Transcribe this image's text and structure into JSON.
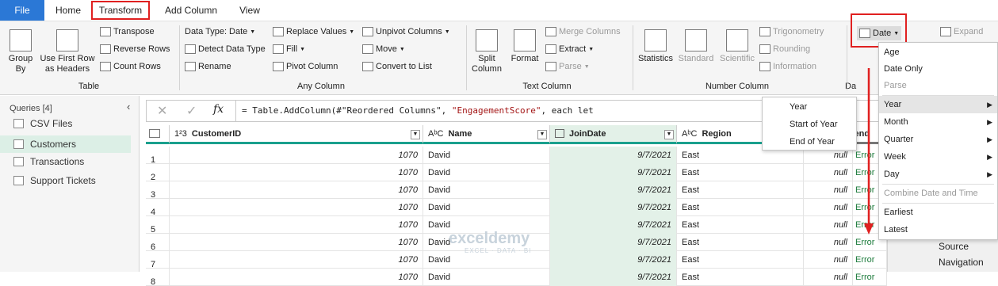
{
  "tabs": {
    "file": "File",
    "home": "Home",
    "transform": "Transform",
    "add_column": "Add Column",
    "view": "View"
  },
  "ribbon": {
    "group_by": "Group\nBy",
    "use_first_row": "Use First Row\nas Headers",
    "transpose": "Transpose",
    "reverse_rows": "Reverse Rows",
    "count_rows": "Count Rows",
    "table_group": "Table",
    "data_type": "Data Type: Date",
    "detect_data_type": "Detect Data Type",
    "rename": "Rename",
    "replace_values": "Replace Values",
    "fill": "Fill",
    "pivot_column": "Pivot Column",
    "unpivot_columns": "Unpivot Columns",
    "move": "Move",
    "convert_to_list": "Convert to List",
    "any_column_group": "Any Column",
    "split_column": "Split\nColumn",
    "format": "Format",
    "merge_columns": "Merge Columns",
    "extract": "Extract",
    "parse": "Parse",
    "text_column_group": "Text Column",
    "statistics": "Statistics",
    "standard": "Standard",
    "scientific": "Scientific",
    "trigonometry": "Trigonometry",
    "rounding": "Rounding",
    "information": "Information",
    "number_column_group": "Number Column",
    "date": "Date",
    "date_group_partial": "Da",
    "expand": "Expand"
  },
  "queries": {
    "header": "Queries [4]",
    "items": [
      "CSV Files",
      "Customers",
      "Transactions",
      "Support Tickets"
    ],
    "selected": 1
  },
  "formula": {
    "text_prefix": "= Table.AddColumn(#\"Reordered Columns\", ",
    "string": "\"EngagementScore\"",
    "text_suffix": ", each let"
  },
  "columns": {
    "customer_id": "CustomerID",
    "name": "Name",
    "join_date": "JoinDate",
    "region": "Region",
    "total_spend": "TotalSpend"
  },
  "rows": [
    {
      "n": "1",
      "id": "1070",
      "name": "David",
      "date": "9/7/2021",
      "region": "East",
      "spend": "null",
      "err": "Error"
    },
    {
      "n": "2",
      "id": "1070",
      "name": "David",
      "date": "9/7/2021",
      "region": "East",
      "spend": "null",
      "err": "Error"
    },
    {
      "n": "3",
      "id": "1070",
      "name": "David",
      "date": "9/7/2021",
      "region": "East",
      "spend": "null",
      "err": "Error"
    },
    {
      "n": "4",
      "id": "1070",
      "name": "David",
      "date": "9/7/2021",
      "region": "East",
      "spend": "null",
      "err": "Error"
    },
    {
      "n": "5",
      "id": "1070",
      "name": "David",
      "date": "9/7/2021",
      "region": "East",
      "spend": "null",
      "err": "Error"
    },
    {
      "n": "6",
      "id": "1070",
      "name": "David",
      "date": "9/7/2021",
      "region": "East",
      "spend": "null",
      "err": "Error"
    },
    {
      "n": "7",
      "id": "1070",
      "name": "David",
      "date": "9/7/2021",
      "region": "East",
      "spend": "null",
      "err": "Error"
    },
    {
      "n": "8",
      "id": "1070",
      "name": "David",
      "date": "9/7/2021",
      "region": "East",
      "spend": "null",
      "err": "Error"
    }
  ],
  "date_menu": {
    "age": "Age",
    "date_only": "Date Only",
    "parse": "Parse",
    "year": "Year",
    "month": "Month",
    "quarter": "Quarter",
    "week": "Week",
    "day": "Day",
    "combine": "Combine Date and Time",
    "earliest": "Earliest",
    "latest": "Latest"
  },
  "year_submenu": {
    "year": "Year",
    "start": "Start of Year",
    "end": "End of Year"
  },
  "right_panel": {
    "source": "Source",
    "navigation": "Navigation"
  },
  "watermark": "exceldemy",
  "watermark_sub": "EXCEL · DATA · BI",
  "colors": {
    "accent": "#2b78d6",
    "red": "#e02020",
    "teal": "#1aa08d",
    "selected_col": "#e3f1e8",
    "error": "#1a7a3a"
  }
}
